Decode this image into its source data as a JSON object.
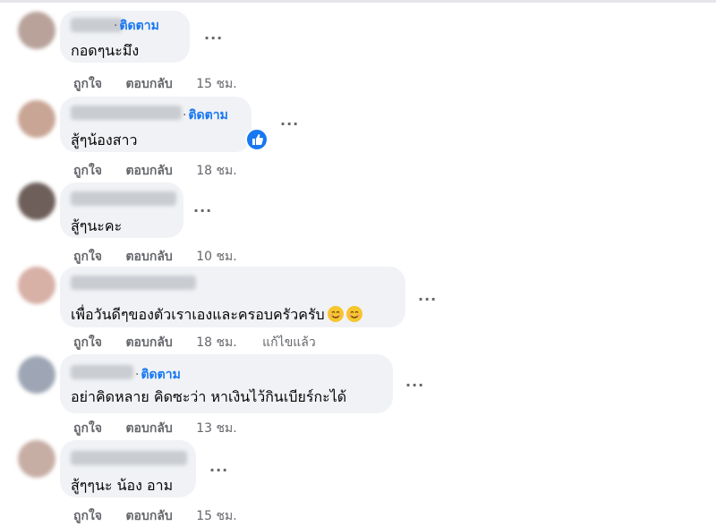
{
  "labels": {
    "follow": "ติดตาม",
    "dot": "·",
    "like": "ถูกใจ",
    "reply": "ตอบกลับ",
    "more": "···"
  },
  "comments": [
    {
      "text": "กอดๆนะมึง",
      "time": "15 ชม.",
      "follow": true
    },
    {
      "text": "สู้ๆน้องสาว",
      "time": "18 ชม.",
      "follow": true,
      "reaction": "like-icon"
    },
    {
      "text": "สู้ๆนะคะ",
      "time": "10 ชม.",
      "follow": false
    },
    {
      "text": "เพื่อวันดีๆของตัวเราเองและครอบครัวครับ",
      "time": "18 ชม.",
      "follow": false,
      "edited": "แก้ไขแล้ว",
      "emojis": [
        "smiling-face-icon",
        "smiling-face-icon"
      ]
    },
    {
      "text": "อย่าคิดหลาย คิดซะว่า หาเงินไว้กินเบียร์กะได้",
      "time": "13 ชม.",
      "follow": true
    },
    {
      "text": "สู้ๆๆนะ น้อง อาม",
      "time": "15 ชม.",
      "follow": false
    }
  ],
  "colors": {
    "bubble": "#f0f2f5",
    "link": "#1877f2",
    "secondary_text": "#65676b",
    "emoji": "#f7c52e"
  }
}
